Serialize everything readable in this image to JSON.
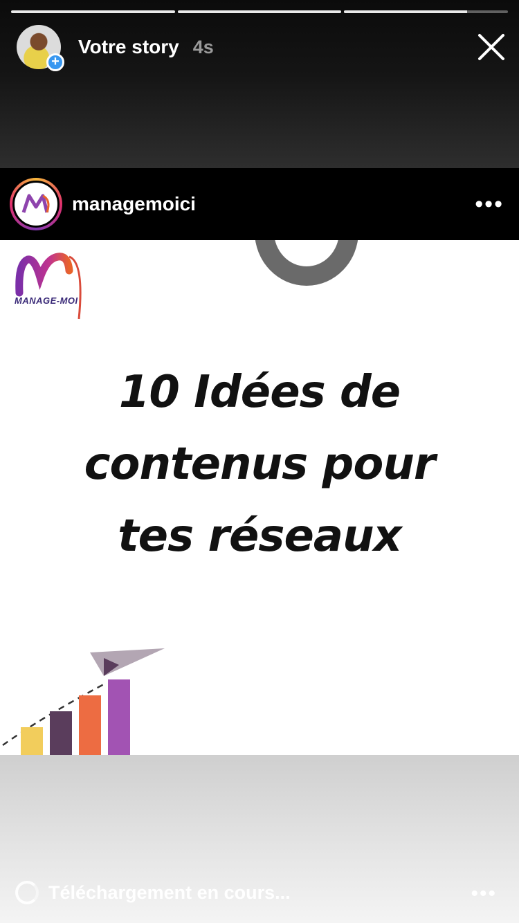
{
  "story": {
    "title": "Votre story",
    "time": "4s",
    "progress": [
      1.0,
      1.0,
      0.75
    ]
  },
  "post": {
    "username": "managemoici",
    "more_label": "•••",
    "logo_text": "MANAGE-MOI",
    "headline_lines": [
      "10 Idées de",
      "contenus pour",
      "tes réseaux"
    ]
  },
  "footer": {
    "status": "Téléchargement en cours...",
    "more_label": "•••"
  },
  "colors": {
    "accent_blue": "#3897f0",
    "bar_yellow": "#f2cd5c",
    "bar_plum": "#5a3d5c",
    "bar_orange": "#ed6c42",
    "bar_purple": "#a253b3",
    "plane": "#9e8f9e"
  }
}
